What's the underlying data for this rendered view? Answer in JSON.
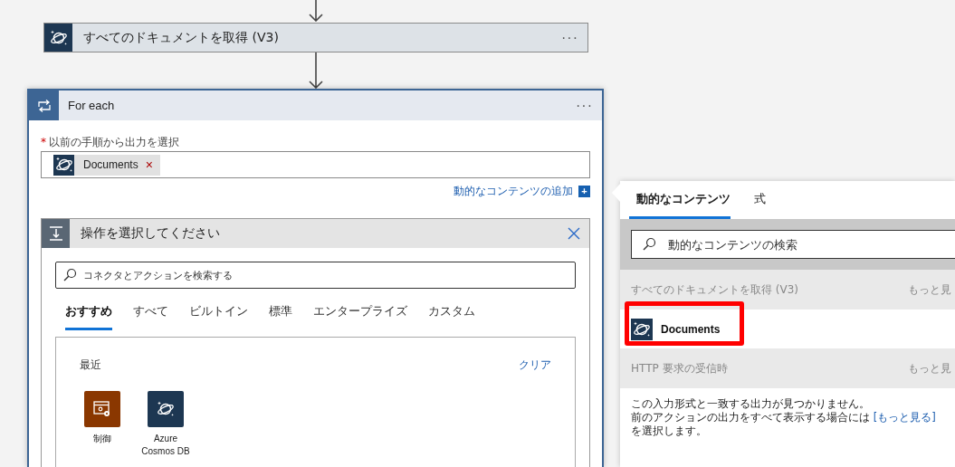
{
  "flow": {
    "action": {
      "title": "すべてのドキュメントを取得 (V3)",
      "menu": "···"
    },
    "foreach": {
      "title": "For each",
      "menu": "···",
      "required_mark": "*",
      "field_label": "以前の手順から出力を選択",
      "token": {
        "label": "Documents",
        "remove": "×"
      },
      "add_dynamic": "動的なコンテンツの追加",
      "add_icon": "+",
      "chooser": {
        "title": "操作を選択してください",
        "search": {
          "placeholder": "コネクタとアクションを検索する"
        },
        "tabs": [
          {
            "label": "おすすめ",
            "selected": true
          },
          {
            "label": "すべて",
            "selected": false
          },
          {
            "label": "ビルトイン",
            "selected": false
          },
          {
            "label": "標準",
            "selected": false
          },
          {
            "label": "エンタープライズ",
            "selected": false
          },
          {
            "label": "カスタム",
            "selected": false
          }
        ],
        "recent": {
          "heading": "最近",
          "clear": "クリア",
          "items": [
            {
              "label": "制御",
              "kind": "control",
              "color": "#8a3700"
            },
            {
              "label": "Azure Cosmos DB",
              "kind": "cosmos",
              "color": "#1d3752"
            }
          ]
        }
      }
    }
  },
  "dynamic_panel": {
    "tabs": [
      {
        "label": "動的なコンテンツ",
        "selected": true
      },
      {
        "label": "式",
        "selected": false
      }
    ],
    "search": {
      "placeholder": "動的なコンテンツの検索"
    },
    "groups": [
      {
        "title": "すべてのドキュメントを取得 (V3)",
        "more": "もっと見",
        "items": [
          {
            "label": "Documents",
            "highlighted": true
          }
        ]
      },
      {
        "title": "HTTP 要求の受信時",
        "more": "もっと見"
      }
    ],
    "message": {
      "line1": "この入力形式と一致する出力が見つかりません。",
      "line2_before": "前のアクションの出力をすべて表示する場合には",
      "link": "[もっと見る]",
      "line2_after": "を選択します。"
    }
  }
}
